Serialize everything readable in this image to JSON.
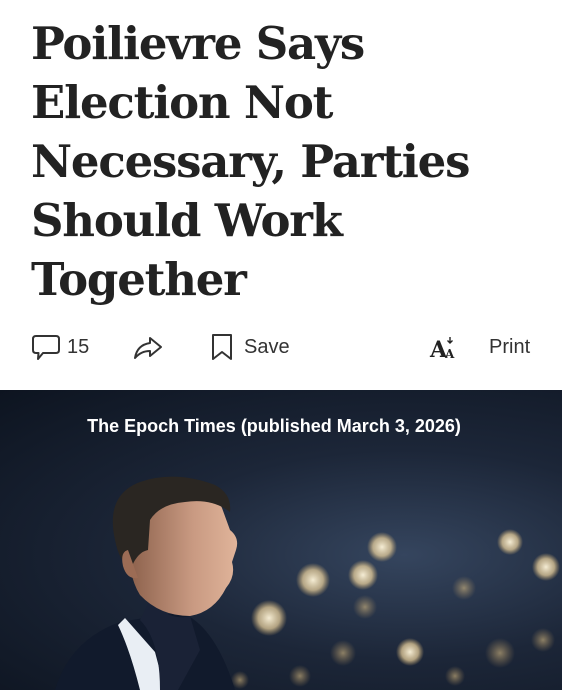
{
  "article": {
    "headline": "Poilievre Says Election Not Necessary, Parties Should Work Together"
  },
  "toolbar": {
    "comment_count": "15",
    "save_label": "Save",
    "print_label": "Print",
    "icons": [
      "comment-icon",
      "share-icon",
      "bookmark-icon",
      "text-size-icon"
    ]
  },
  "photo": {
    "caption": "The Epoch Times (published March 3, 2026)"
  },
  "colors": {
    "text": "#222222",
    "toolbar_text": "#333333",
    "photo_background": "#1c2638"
  }
}
